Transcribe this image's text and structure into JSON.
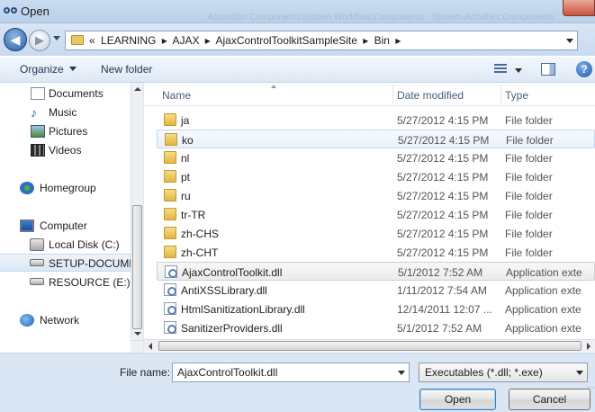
{
  "window": {
    "title": "Open"
  },
  "background_titles": [
    "Accordion Components",
    "System.Workflow.Components",
    "System.Activities.Components"
  ],
  "address": {
    "crumbs": [
      "«",
      "LEARNING",
      "▸",
      "AJAX",
      "▸",
      "AjaxControlToolkitSampleSite",
      "▸",
      "Bin",
      "▸"
    ]
  },
  "toolbar": {
    "organize": "Organize",
    "new_folder": "New folder",
    "help": "?"
  },
  "nav": {
    "items": [
      {
        "label": "Documents",
        "icon": "documents-icon"
      },
      {
        "label": "Music",
        "icon": "music-icon"
      },
      {
        "label": "Pictures",
        "icon": "pictures-icon"
      },
      {
        "label": "Videos",
        "icon": "videos-icon"
      },
      {
        "label": "Homegroup",
        "icon": "homegroup-icon"
      },
      {
        "label": "Computer",
        "icon": "computer-icon"
      },
      {
        "label": "Local Disk (C:)",
        "icon": "drive-icon"
      },
      {
        "label": "SETUP-DOCUME",
        "icon": "drive-icon"
      },
      {
        "label": "RESOURCE (E:)",
        "icon": "drive-icon"
      },
      {
        "label": "Network",
        "icon": "network-icon"
      }
    ]
  },
  "columns": {
    "name": "Name",
    "date": "Date modified",
    "type": "Type"
  },
  "files": [
    {
      "name": "ja",
      "date": "5/27/2012 4:15 PM",
      "type": "File folder",
      "kind": "folder"
    },
    {
      "name": "ko",
      "date": "5/27/2012 4:15 PM",
      "type": "File folder",
      "kind": "folder"
    },
    {
      "name": "nl",
      "date": "5/27/2012 4:15 PM",
      "type": "File folder",
      "kind": "folder"
    },
    {
      "name": "pt",
      "date": "5/27/2012 4:15 PM",
      "type": "File folder",
      "kind": "folder"
    },
    {
      "name": "ru",
      "date": "5/27/2012 4:15 PM",
      "type": "File folder",
      "kind": "folder"
    },
    {
      "name": "tr-TR",
      "date": "5/27/2012 4:15 PM",
      "type": "File folder",
      "kind": "folder"
    },
    {
      "name": "zh-CHS",
      "date": "5/27/2012 4:15 PM",
      "type": "File folder",
      "kind": "folder"
    },
    {
      "name": "zh-CHT",
      "date": "5/27/2012 4:15 PM",
      "type": "File folder",
      "kind": "folder"
    },
    {
      "name": "AjaxControlToolkit.dll",
      "date": "5/1/2012 7:52 AM",
      "type": "Application exte",
      "kind": "dll"
    },
    {
      "name": "AntiXSSLibrary.dll",
      "date": "1/11/2012 7:54 AM",
      "type": "Application exte",
      "kind": "dll"
    },
    {
      "name": "HtmlSanitizationLibrary.dll",
      "date": "12/14/2011 12:07 ...",
      "type": "Application exte",
      "kind": "dll"
    },
    {
      "name": "SanitizerProviders.dll",
      "date": "5/1/2012 7:52 AM",
      "type": "Application exte",
      "kind": "dll"
    }
  ],
  "filename": {
    "label": "File name:",
    "value": "AjaxControlToolkit.dll"
  },
  "filetype": {
    "value": "Executables (*.dll; *.exe)"
  },
  "buttons": {
    "open": "Open",
    "cancel": "Cancel"
  },
  "state": {
    "hovered_row": "ko",
    "selected_row": "AjaxControlToolkit.dll",
    "selected_nav": "SETUP-DOCUME"
  },
  "colors": {
    "accent": "#3c7fb1",
    "folder": "#e3b546",
    "window_frame": "#b9d0ea"
  }
}
